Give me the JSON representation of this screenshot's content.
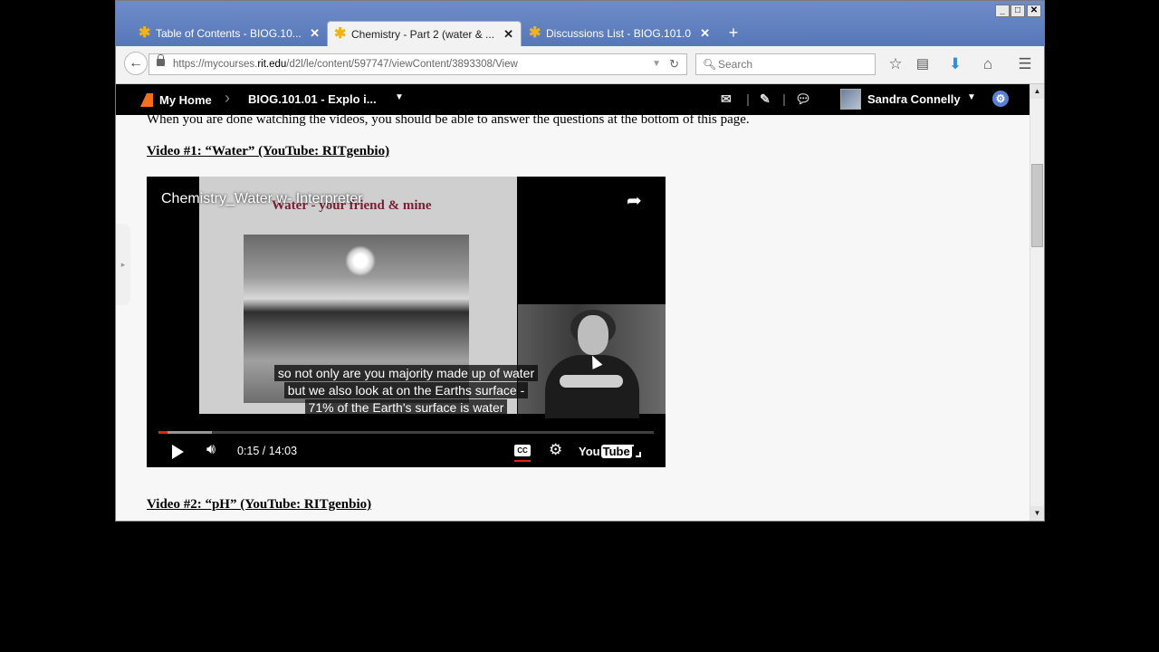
{
  "browser": {
    "tabs": [
      {
        "label": "Table of Contents - BIOG.10...",
        "active": false
      },
      {
        "label": "Chemistry - Part 2 (water & ...",
        "active": true
      },
      {
        "label": "Discussions List - BIOG.101.0...",
        "active": false
      }
    ],
    "url_prefix": "https://mycourses.",
    "url_host": "rit.edu",
    "url_rest": "/d2l/le/content/597747/viewContent/3893308/View",
    "search_placeholder": "Search"
  },
  "d2l": {
    "home_label": "My Home",
    "course_label": "BIOG.101.01 - Explo i...",
    "user_name": "Sandra Connelly"
  },
  "content": {
    "intro": "When you are done watching the videos, you should be able to answer the questions at the bottom of this page.",
    "video1_heading": "Video #1: “Water” (YouTube: RITgenbio)",
    "video2_heading": "Video #2: “pH” (YouTube: RITgenbio)"
  },
  "video": {
    "title": "Chemistry_Water w- Interpreter",
    "slide_title": "Water - your friend & mine",
    "captions": [
      "so not only are you majority made up of water",
      "but we also look at on the Earths surface -",
      "71% of the Earth's surface is water"
    ],
    "time": "0:15 / 14:03",
    "progress_played": 0.018,
    "progress_loaded": 0.107,
    "cc_label": "CC",
    "youtube_label_a": "You",
    "youtube_label_b": "Tube"
  },
  "icons": [
    "back-icon",
    "lock-icon",
    "reload-icon",
    "search-icon",
    "bookmark-star-icon",
    "reading-list-icon",
    "download-icon",
    "home-icon",
    "menu-icon",
    "mail-icon",
    "notification-icon",
    "chat-icon",
    "settings-gear-icon",
    "share-icon",
    "play-icon",
    "volume-icon",
    "closed-captions-icon",
    "gear-icon",
    "fullscreen-icon"
  ]
}
